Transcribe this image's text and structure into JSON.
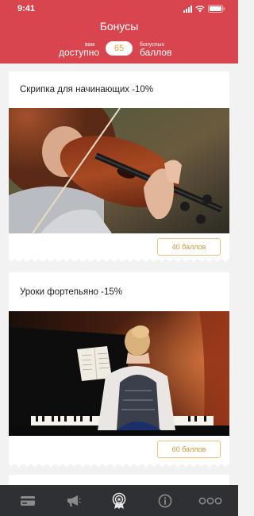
{
  "status": {
    "time": "9:41"
  },
  "header": {
    "title": "Бонусы",
    "available_small": "вам",
    "available_big": "доступно",
    "points_value": "65",
    "points_small": "бонусных",
    "points_big": "баллов"
  },
  "offers": [
    {
      "title": "Скрипка для начинающих -10%",
      "cost_label": "40 баллов",
      "image": "violin-photo"
    },
    {
      "title": "Уроки фортепьяно -15%",
      "cost_label": "60 баллов",
      "image": "piano-photo"
    }
  ],
  "tabbar": {
    "tabs": [
      {
        "icon": "card-icon",
        "active": false
      },
      {
        "icon": "megaphone-icon",
        "active": false
      },
      {
        "icon": "award-badge-icon",
        "active": true
      },
      {
        "icon": "info-icon",
        "active": false
      },
      {
        "icon": "more-dots-icon",
        "active": false
      }
    ]
  },
  "colors": {
    "header_bg": "#d9454e",
    "accent_gold": "#e2a43a",
    "tabbar_bg": "#2f3033",
    "tab_icon": "#8a8b8d",
    "tab_icon_active": "#e6e6e6"
  }
}
